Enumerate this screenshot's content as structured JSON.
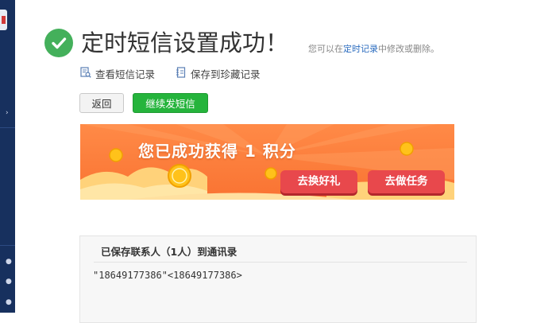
{
  "header": {
    "title": "定时短信设置成功！",
    "note_prefix": "您可以在",
    "note_link": "定时记录",
    "note_suffix": "中修改或删除。"
  },
  "links": {
    "view_records": "查看短信记录",
    "save_favorites": "保存到珍藏记录"
  },
  "buttons": {
    "back": "返回",
    "continue": "继续发短信"
  },
  "banner": {
    "headline": "您已成功获得 1 积分",
    "exchange_gift": "去换好礼",
    "do_tasks": "去做任务"
  },
  "contacts": {
    "heading": "已保存联系人（1人）到通讯录",
    "entry": "\"18649177386\"<18649177386>"
  },
  "colors": {
    "success_green": "#44b05b",
    "primary_button": "#25b43c",
    "banner_orange": "#fb7d3c",
    "banner_button": "#e8484c",
    "sidebar": "#17305e",
    "link_blue": "#2b6cbf"
  },
  "icons": [
    "check-circle-icon",
    "search-document-icon",
    "notebook-icon",
    "coin-icon"
  ]
}
